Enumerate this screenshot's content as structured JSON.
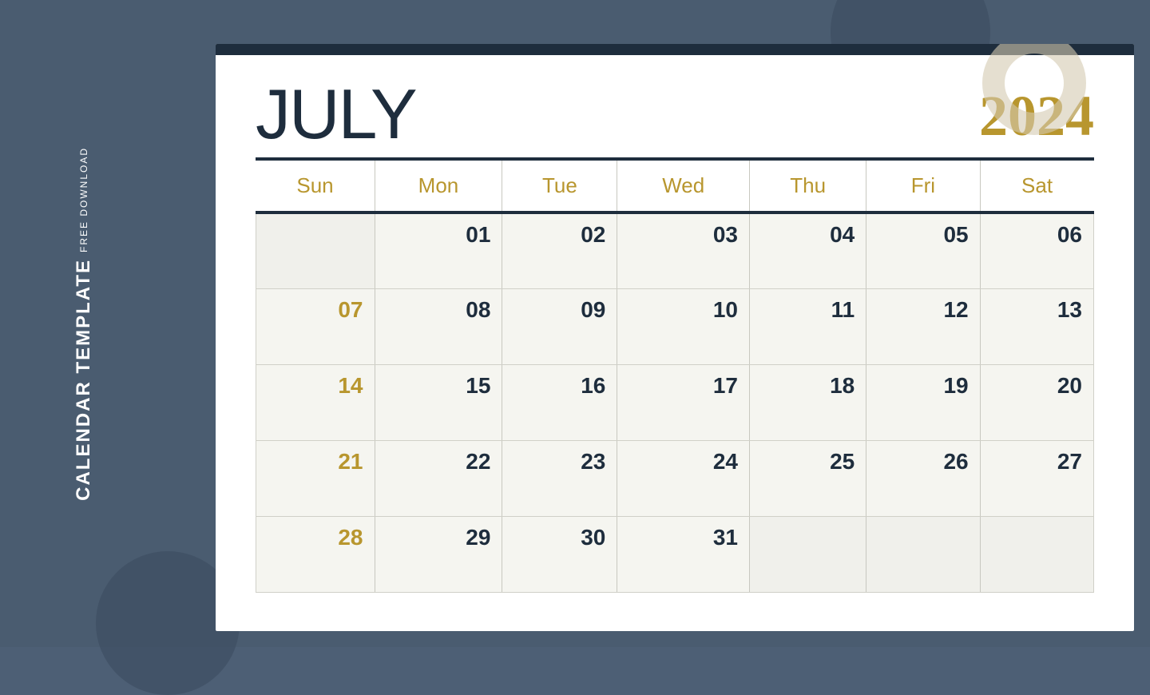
{
  "background": {
    "color": "#4a5c70"
  },
  "sidebar": {
    "free_download_label": "FREE DOWNLOAD",
    "calendar_template_label": "CALENDAR TEMPLATE"
  },
  "calendar": {
    "month": "JULY",
    "year": "2024",
    "days_of_week": [
      "Sun",
      "Mon",
      "Tue",
      "Wed",
      "Thu",
      "Fri",
      "Sat"
    ],
    "weeks": [
      [
        "",
        "01",
        "02",
        "03",
        "04",
        "05",
        "06"
      ],
      [
        "07",
        "08",
        "09",
        "10",
        "11",
        "12",
        "13"
      ],
      [
        "14",
        "15",
        "16",
        "17",
        "18",
        "19",
        "20"
      ],
      [
        "21",
        "22",
        "23",
        "24",
        "25",
        "26",
        "27"
      ],
      [
        "28",
        "29",
        "30",
        "31",
        "",
        "",
        ""
      ]
    ],
    "sunday_dates": [
      "07",
      "14",
      "21",
      "28"
    ]
  }
}
